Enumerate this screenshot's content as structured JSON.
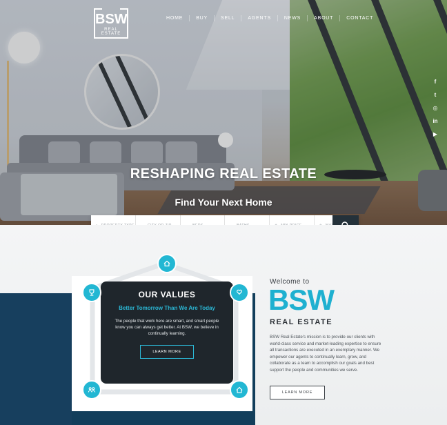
{
  "logo": {
    "main": "BSW",
    "sub": "REAL ESTATE"
  },
  "nav": {
    "items": [
      "HOME",
      "BUY",
      "SELL",
      "AGENTS",
      "NEWS",
      "ABOUT",
      "CONTACT"
    ]
  },
  "social": {
    "icons": [
      "facebook-icon",
      "twitter-icon",
      "instagram-icon",
      "linkedin-icon",
      "youtube-icon"
    ],
    "glyphs": [
      "f",
      "t",
      "◎",
      "in",
      "▶"
    ]
  },
  "hero": {
    "title": "RESHAPING REAL ESTATE",
    "subtitle": "Find Your Next Home"
  },
  "search": {
    "fields": [
      {
        "label": "PROPERTY TYPE",
        "icon": "home-icon"
      },
      {
        "label": "CITY OR ZIP",
        "icon": "map-pin-icon"
      },
      {
        "label": "BEDS",
        "icon": "bed-icon"
      },
      {
        "label": "BATHS",
        "icon": "bath-icon"
      },
      {
        "label": "MIN PRICE",
        "icon": "price-tag-icon"
      },
      {
        "label": "MAX PRICE",
        "icon": "price-tag-icon"
      }
    ],
    "button_icon": "search-icon"
  },
  "values": {
    "title": "OUR VALUES",
    "tagline": "Better Tomorrow Than We Are Today",
    "body": "The people that work here are smart, and smart people know you can always get better. At BSW, we believe in continually learning.",
    "button": "LEARN MORE"
  },
  "welcome": {
    "intro": "Welcome to",
    "brand": "BSW",
    "brand_sub": "REAL ESTATE",
    "mission": "BSW Real Estate's mission is to provide our clients with world-class service and market-leading expertise to ensure all transactions are executed in an exemplary manner. We empower our agents to continually learn, grow, and collaborate as a team to accomplish our goals and best support the people and communities we serve.",
    "button": "LEARN MORE"
  },
  "colors": {
    "accent": "#22b7d3",
    "navy": "#123e5b",
    "dark": "#1f262c"
  }
}
